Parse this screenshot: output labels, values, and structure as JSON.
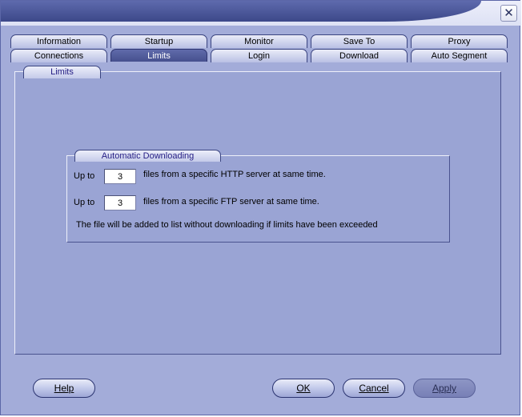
{
  "window": {
    "close_glyph": "✕",
    "close_icon": "close-icon"
  },
  "tabs": {
    "row_top": [
      {
        "label": "Information"
      },
      {
        "label": "Startup"
      },
      {
        "label": "Monitor"
      },
      {
        "label": "Save To"
      },
      {
        "label": "Proxy"
      }
    ],
    "row_bottom": [
      {
        "label": "Connections"
      },
      {
        "label": "Limits",
        "active": true
      },
      {
        "label": "Login"
      },
      {
        "label": "Download"
      },
      {
        "label": "Auto Segment"
      }
    ]
  },
  "panel": {
    "title": "Limits",
    "group": {
      "title": "Automatic Downloading",
      "http_prefix": "Up to",
      "http_value": "3",
      "http_suffix": "files from a specific HTTP server at same time.",
      "ftp_prefix": "Up to",
      "ftp_value": "3",
      "ftp_suffix": "files from a specific FTP server at same time.",
      "note": "The file will be added to list without downloading if limits have been exceeded"
    }
  },
  "buttons": {
    "help": "Help",
    "ok": "OK",
    "cancel": "Cancel",
    "apply": "Apply"
  },
  "colors": {
    "window_bg": "#a3acd9",
    "panel_bg": "#9aa4d4",
    "title_bar": "#4a5697",
    "active_tab": "#505a99",
    "group_title_text": "#241d84"
  }
}
